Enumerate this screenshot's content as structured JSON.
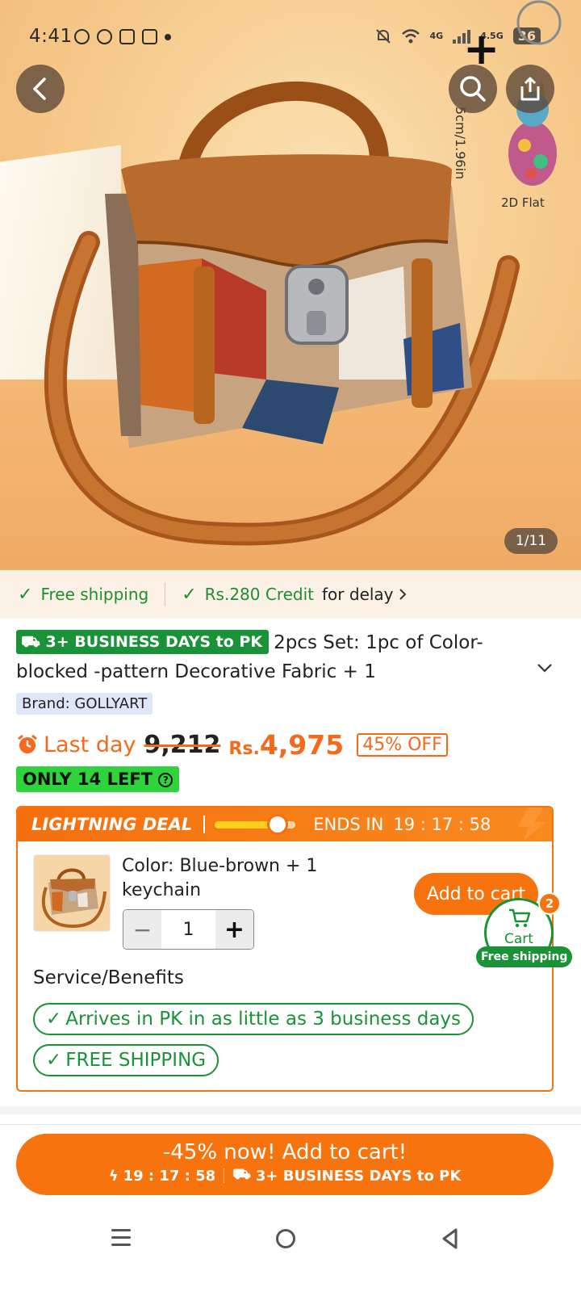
{
  "statusbar": {
    "time": "4:41",
    "network_a": "4G",
    "network_b": "4.5G",
    "battery": "36"
  },
  "hero": {
    "inset_dimension": "5cm/1.96in",
    "inset_label": "2D Flat",
    "image_counter": "1/11"
  },
  "benefits": {
    "free_shipping": "Free shipping",
    "credit": "Rs.280 Credit",
    "credit_suffix": "for delay"
  },
  "product": {
    "ship_badge": "3+ BUSINESS DAYS to PK",
    "title": "2pcs Set: 1pc of Color-blocked -pattern Decorative Fabric + 1",
    "brand": "Brand: GOLLYART"
  },
  "price": {
    "last_day": "Last day",
    "old_price": "9,212",
    "currency": "Rs.",
    "current_price": "4,975",
    "discount": "45% OFF",
    "stock": "ONLY 14 LEFT"
  },
  "deal": {
    "title": "LIGHTNING DEAL",
    "ends_in": "ENDS IN",
    "timer": "19 : 17 : 58",
    "progress": 0.78,
    "variant": "Color: Blue-brown + 1 keychain",
    "quantity": "1",
    "add_to_cart": "Add to cart",
    "services_title": "Service/Benefits",
    "services": [
      "Arrives in PK in as little as 3 business days",
      "FREE SHIPPING"
    ]
  },
  "floating_cart": {
    "label": "Cart",
    "count": "2",
    "shipping": "Free shipping"
  },
  "cta": {
    "main": "-45% now! Add to cart!",
    "timer": "19 : 17 : 58",
    "shipping": "3+ BUSINESS DAYS to PK"
  },
  "colors": {
    "accent": "#f6730d",
    "green": "#1a9237",
    "stock_green": "#2fd33c"
  }
}
